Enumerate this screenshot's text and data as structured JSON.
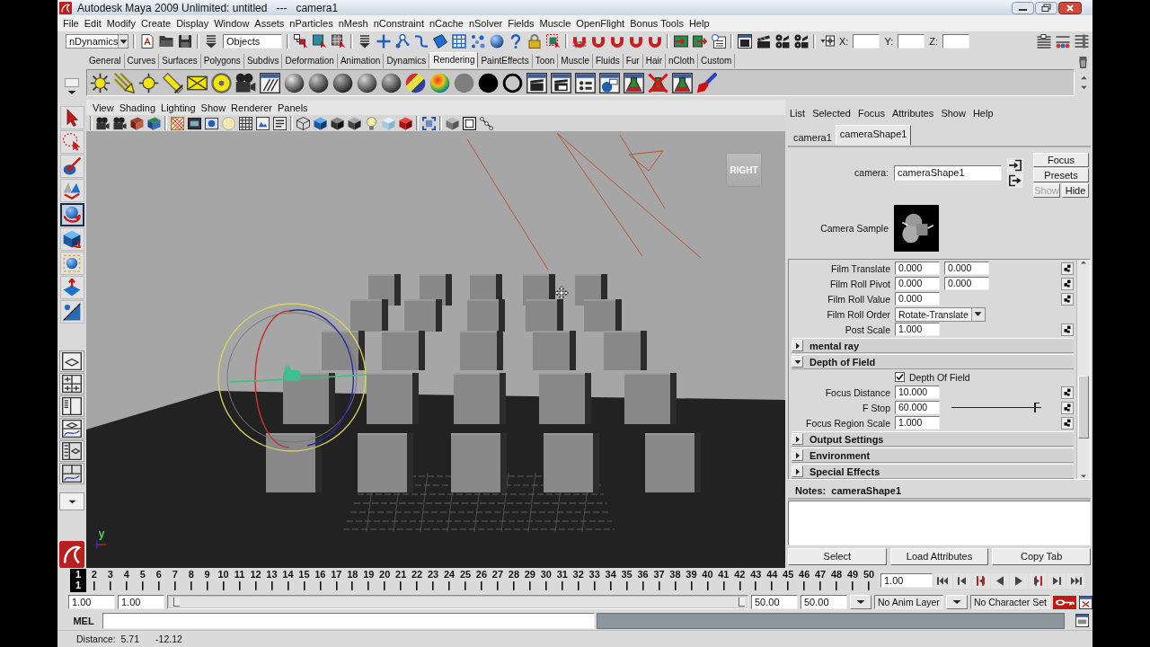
{
  "window": {
    "title": "Autodesk Maya 2009 Unlimited: untitled   ---   camera1"
  },
  "menu_bar": [
    "File",
    "Edit",
    "Modify",
    "Create",
    "Display",
    "Window",
    "Assets",
    "nParticles",
    "nMesh",
    "nConstraint",
    "nCache",
    "nSolver",
    "Fields",
    "Muscle",
    "OpenFlight",
    "Bonus Tools",
    "Help"
  ],
  "status_line": {
    "menu_set": "nDynamics",
    "selection_field": "Objects",
    "coordinate_labels": [
      "X:",
      "Y:",
      "Z:"
    ]
  },
  "shelf": {
    "tabs": [
      {
        "label": "General",
        "selected": false
      },
      {
        "label": "Curves",
        "selected": false
      },
      {
        "label": "Surfaces",
        "selected": false
      },
      {
        "label": "Polygons",
        "selected": false
      },
      {
        "label": "Subdivs",
        "selected": false
      },
      {
        "label": "Deformation",
        "selected": false
      },
      {
        "label": "Animation",
        "selected": false
      },
      {
        "label": "Dynamics",
        "selected": false
      },
      {
        "label": "Rendering",
        "selected": true
      },
      {
        "label": "PaintEffects",
        "selected": false
      },
      {
        "label": "Toon",
        "selected": false
      },
      {
        "label": "Muscle",
        "selected": false
      },
      {
        "label": "Fluids",
        "selected": false
      },
      {
        "label": "Fur",
        "selected": false
      },
      {
        "label": "Hair",
        "selected": false
      },
      {
        "label": "nCloth",
        "selected": false
      },
      {
        "label": "Custom",
        "selected": false
      }
    ]
  },
  "toolbox": {
    "tools": [
      {
        "kind": "select",
        "selected": false
      },
      {
        "kind": "lasso",
        "selected": false
      },
      {
        "kind": "paint",
        "selected": false
      },
      {
        "kind": "move",
        "selected": false
      },
      {
        "kind": "rotate",
        "selected": true
      },
      {
        "kind": "scale",
        "selected": false
      },
      {
        "kind": "universal",
        "selected": false
      },
      {
        "kind": "soft",
        "selected": false
      },
      {
        "kind": "manip",
        "selected": false
      }
    ]
  },
  "viewport": {
    "menus": [
      "View",
      "Shading",
      "Lighting",
      "Show",
      "Renderer",
      "Panels"
    ],
    "view_cube_label": "RIGHT",
    "axis_label": "y"
  },
  "attribute_editor": {
    "menus": [
      "List",
      "Selected",
      "Focus",
      "Attributes",
      "Show",
      "Help"
    ],
    "tabs": [
      {
        "label": "camera1",
        "selected": false
      },
      {
        "label": "cameraShape1",
        "selected": true
      }
    ],
    "node_label": "camera:",
    "node_name": "cameraShape1",
    "buttons": [
      {
        "label": "Focus",
        "disabled": false
      },
      {
        "label": "Presets",
        "disabled": false
      },
      {
        "label": "Show",
        "disabled": true
      },
      {
        "label": "Hide",
        "disabled": false
      }
    ],
    "sample_label": "Camera Sample",
    "rows": [
      {
        "kind": "fields",
        "label": "Film Translate",
        "values": [
          "0.000",
          "0.000"
        ]
      },
      {
        "kind": "fields",
        "label": "Film Roll Pivot",
        "values": [
          "0.000",
          "0.000"
        ]
      },
      {
        "kind": "fields",
        "label": "Film Roll Value",
        "values": [
          "0.000"
        ]
      },
      {
        "kind": "enum",
        "label": "Film Roll Order",
        "value": "Rotate-Translate"
      },
      {
        "kind": "fields",
        "label": "Post Scale",
        "values": [
          "1.000"
        ]
      }
    ],
    "sections": [
      {
        "title": "mental ray",
        "expanded": false
      },
      {
        "title": "Depth of Field",
        "expanded": true,
        "rows": [
          {
            "kind": "checkbox",
            "label": "Depth Of Field",
            "checked": true
          },
          {
            "kind": "fields",
            "label": "Focus Distance",
            "values": [
              "10.000"
            ]
          },
          {
            "kind": "slider",
            "label": "F Stop",
            "values": [
              "60.000"
            ],
            "level": 0.95
          },
          {
            "kind": "fields",
            "label": "Focus Region Scale",
            "values": [
              "1.000"
            ]
          }
        ]
      },
      {
        "title": "Output Settings",
        "expanded": false
      },
      {
        "title": "Environment",
        "expanded": false
      },
      {
        "title": "Special Effects",
        "expanded": false
      }
    ],
    "notes_label": "Notes:  cameraShape1",
    "bottom_buttons": [
      "Select",
      "Load Attributes",
      "Copy Tab"
    ]
  },
  "time_slider": {
    "frames": [
      {
        "label": "1",
        "selected": true
      },
      {
        "label": "2",
        "selected": false
      },
      {
        "label": "3",
        "selected": false
      },
      {
        "label": "4",
        "selected": false
      },
      {
        "label": "5",
        "selected": false
      },
      {
        "label": "6",
        "selected": false
      },
      {
        "label": "7",
        "selected": false
      },
      {
        "label": "8",
        "selected": false
      },
      {
        "label": "9",
        "selected": false
      },
      {
        "label": "10",
        "selected": false
      },
      {
        "label": "11",
        "selected": false
      },
      {
        "label": "12",
        "selected": false
      },
      {
        "label": "13",
        "selected": false
      },
      {
        "label": "14",
        "selected": false
      },
      {
        "label": "15",
        "selected": false
      },
      {
        "label": "16",
        "selected": false
      },
      {
        "label": "17",
        "selected": false
      },
      {
        "label": "18",
        "selected": false
      },
      {
        "label": "19",
        "selected": false
      },
      {
        "label": "20",
        "selected": false
      },
      {
        "label": "21",
        "selected": false
      },
      {
        "label": "22",
        "selected": false
      },
      {
        "label": "23",
        "selected": false
      },
      {
        "label": "24",
        "selected": false
      },
      {
        "label": "25",
        "selected": false
      },
      {
        "label": "26",
        "selected": false
      },
      {
        "label": "27",
        "selected": false
      },
      {
        "label": "28",
        "selected": false
      },
      {
        "label": "29",
        "selected": false
      },
      {
        "label": "30",
        "selected": false
      },
      {
        "label": "31",
        "selected": false
      },
      {
        "label": "32",
        "selected": false
      },
      {
        "label": "33",
        "selected": false
      },
      {
        "label": "34",
        "selected": false
      },
      {
        "label": "35",
        "selected": false
      },
      {
        "label": "36",
        "selected": false
      },
      {
        "label": "37",
        "selected": false
      },
      {
        "label": "38",
        "selected": false
      },
      {
        "label": "39",
        "selected": false
      },
      {
        "label": "40",
        "selected": false
      },
      {
        "label": "41",
        "selected": false
      },
      {
        "label": "42",
        "selected": false
      },
      {
        "label": "43",
        "selected": false
      },
      {
        "label": "44",
        "selected": false
      },
      {
        "label": "45",
        "selected": false
      },
      {
        "label": "46",
        "selected": false
      },
      {
        "label": "47",
        "selected": false
      },
      {
        "label": "48",
        "selected": false
      },
      {
        "label": "49",
        "selected": false
      },
      {
        "label": "50",
        "selected": false
      }
    ],
    "current_frame_label": "1",
    "current_time": "1.00"
  },
  "range_slider": {
    "start_time": "1.00",
    "range_start": "1.00",
    "level": 1,
    "range_end": "50.00",
    "end_time": "50.00",
    "anim_layer": "No Anim Layer",
    "character_set": "No Character Set"
  },
  "command_line": {
    "language": "MEL"
  },
  "help_line": {
    "texts": [
      "Distance:  5.71",
      "-12.12"
    ]
  }
}
